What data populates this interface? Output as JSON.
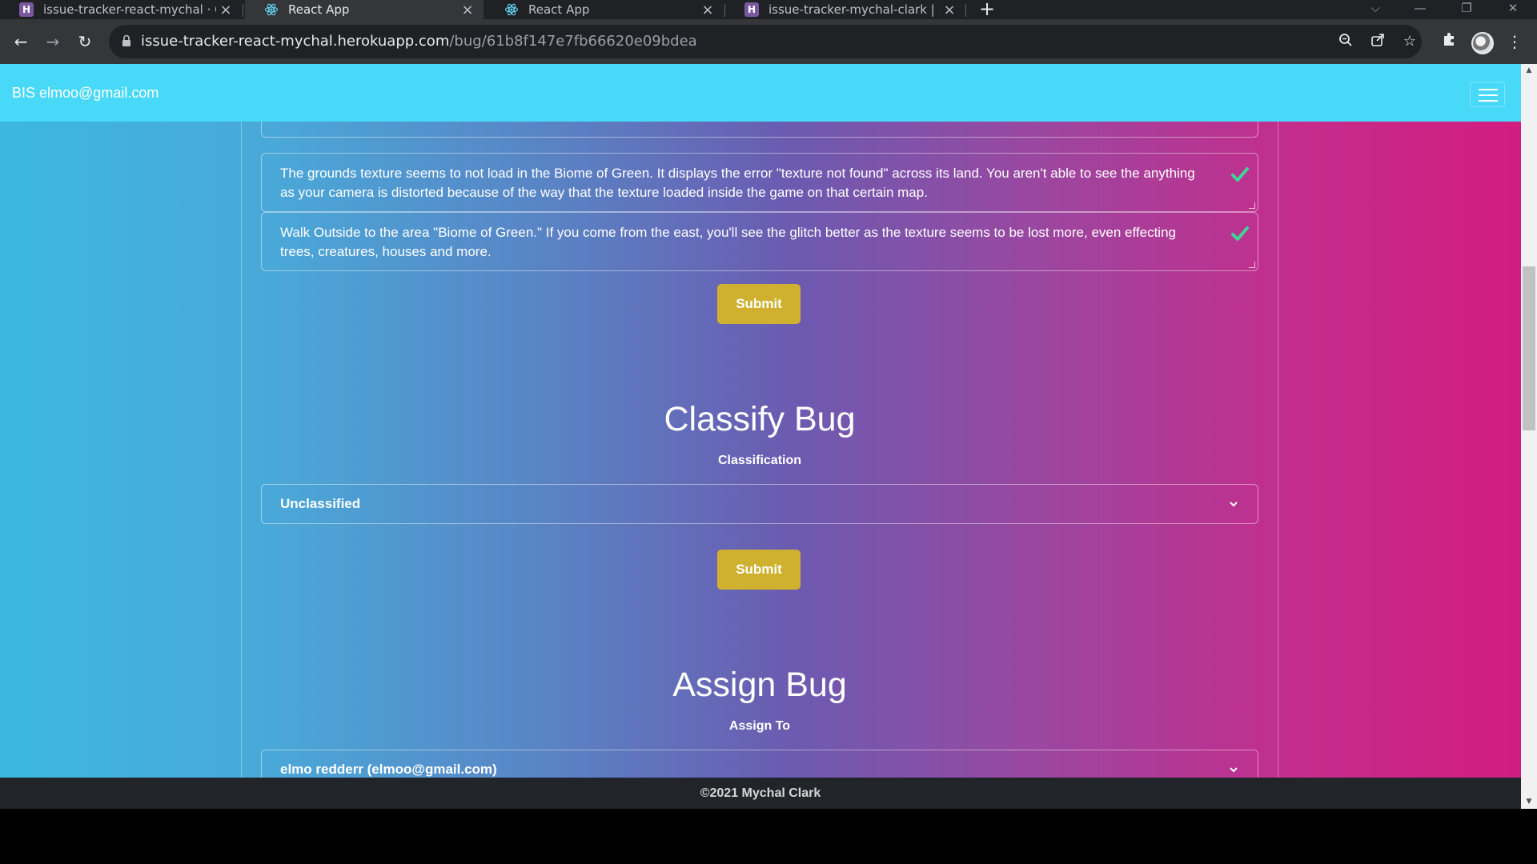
{
  "browser": {
    "tabs": [
      {
        "title": "issue-tracker-react-mychal · GitH",
        "icon": "heroku-icon",
        "active": false
      },
      {
        "title": "React App",
        "icon": "react-icon",
        "active": true
      },
      {
        "title": "React App",
        "icon": "react-icon",
        "active": false
      },
      {
        "title": "issue-tracker-mychal-clark | Hero",
        "icon": "heroku-icon",
        "active": false
      }
    ],
    "url_host": "issue-tracker-react-mychal.herokuapp.com",
    "url_path": "/bug/61b8f147e7fb66620e09bdea"
  },
  "navbar": {
    "brand": "BIS elmoo@gmail.com"
  },
  "notes": [
    {
      "text": "The grounds texture seems to not load in the Biome of Green. It displays the error \"texture not found\" across its land.  You aren't able to see the anything as your camera is distorted because of the way that the texture loaded inside the game on that certain map."
    },
    {
      "text": "Walk Outside to the area \"Biome of Green.\"  If you come from the east, you'll see the glitch better as the texture seems to be lost more, even effecting trees, creatures, houses and more."
    }
  ],
  "submit_label": "Submit",
  "classify": {
    "heading": "Classify Bug",
    "label": "Classification",
    "selected": "Unclassified"
  },
  "assign": {
    "heading": "Assign Bug",
    "label": "Assign To",
    "selected": "elmo redderr (elmoo@gmail.com)"
  },
  "footer": {
    "text": "©2021 Mychal Clark"
  },
  "colors": {
    "navbar": "#48d8f8",
    "submit_button": "#cfb12f",
    "check": "#3ed598",
    "footer": "#212529"
  }
}
